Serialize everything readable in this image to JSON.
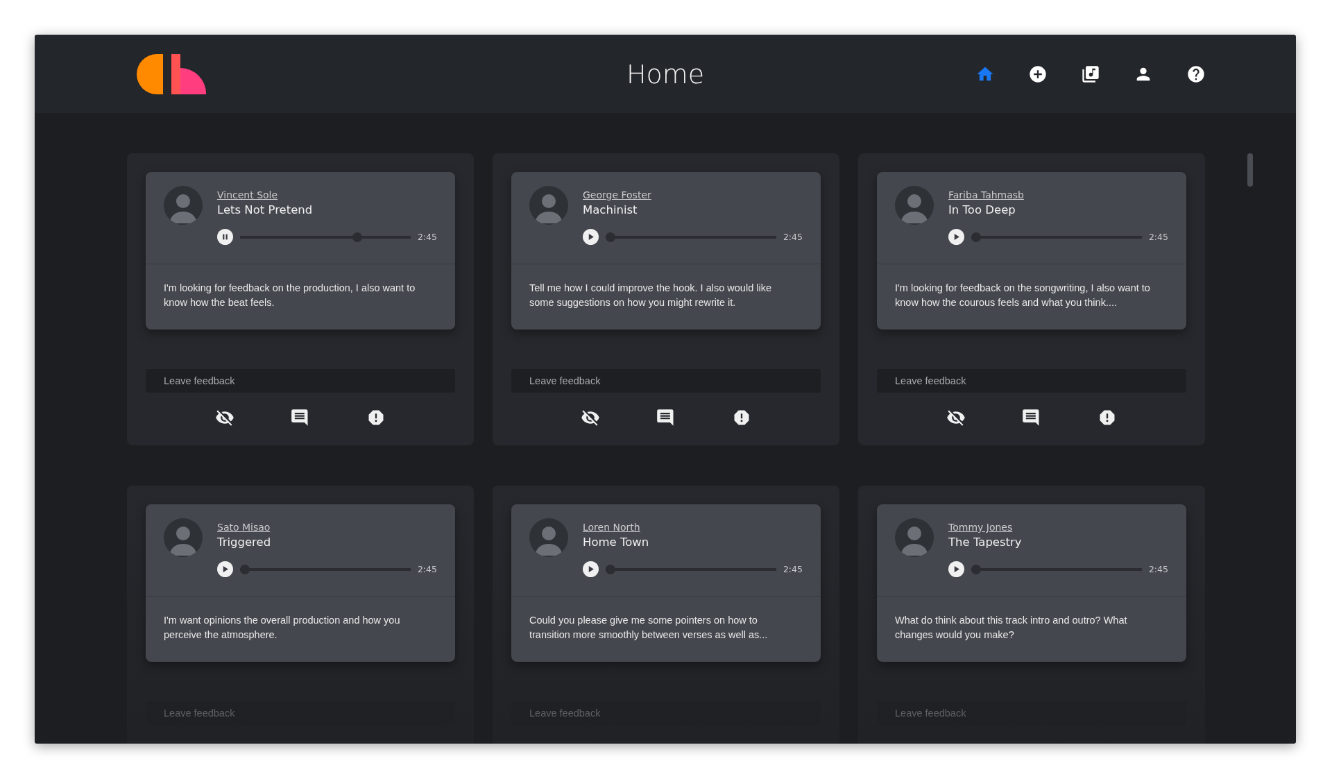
{
  "header": {
    "title": "Home",
    "nav": [
      {
        "kind": "home",
        "selected": true
      },
      {
        "kind": "add",
        "selected": false
      },
      {
        "kind": "library",
        "selected": false
      },
      {
        "kind": "profile",
        "selected": false
      },
      {
        "kind": "help",
        "selected": false
      }
    ]
  },
  "posts": [
    {
      "artist": "Vincent Sole",
      "track": "Lets Not Pretend",
      "playing": true,
      "level": 0.7,
      "duration": "2:45",
      "description": "I'm looking for feedback on the production, I also want to know how the beat feels.",
      "feedback_placeholder": "Leave feedback",
      "dimmed": false,
      "actions_shown": true
    },
    {
      "artist": "George Foster",
      "track": "Machinist",
      "playing": false,
      "level": 0,
      "duration": "2:45",
      "description": "Tell me how I could improve the hook. I also would like some suggestions on how you might rewrite it.",
      "feedback_placeholder": "Leave feedback",
      "dimmed": false,
      "actions_shown": true
    },
    {
      "artist": "Fariba Tahmasb",
      "track": "In Too Deep",
      "playing": false,
      "level": 0,
      "duration": "2:45",
      "description": "I'm looking for feedback on the songwriting, I also want to know how the courous feels and what you think....",
      "feedback_placeholder": "Leave feedback",
      "dimmed": false,
      "actions_shown": true
    },
    {
      "artist": "Sato Misao",
      "track": "Triggered",
      "playing": false,
      "level": 0,
      "duration": "2:45",
      "description": "I'm want opinions the overall production and how you perceive the atmosphere.",
      "feedback_placeholder": "Leave feedback",
      "dimmed": true,
      "actions_shown": false
    },
    {
      "artist": "Loren North",
      "track": "Home Town",
      "playing": false,
      "level": 0,
      "duration": "2:45",
      "description": "Could you please give me some pointers on how to transition more smoothly between verses as well as...",
      "feedback_placeholder": "Leave feedback",
      "dimmed": true,
      "actions_shown": false
    },
    {
      "artist": "Tommy Jones",
      "track": "The Tapestry",
      "playing": false,
      "level": 0,
      "duration": "2:45",
      "description": "What do think about this track intro and outro? What changes would you make?",
      "feedback_placeholder": "Leave feedback",
      "dimmed": true,
      "actions_shown": false
    }
  ]
}
